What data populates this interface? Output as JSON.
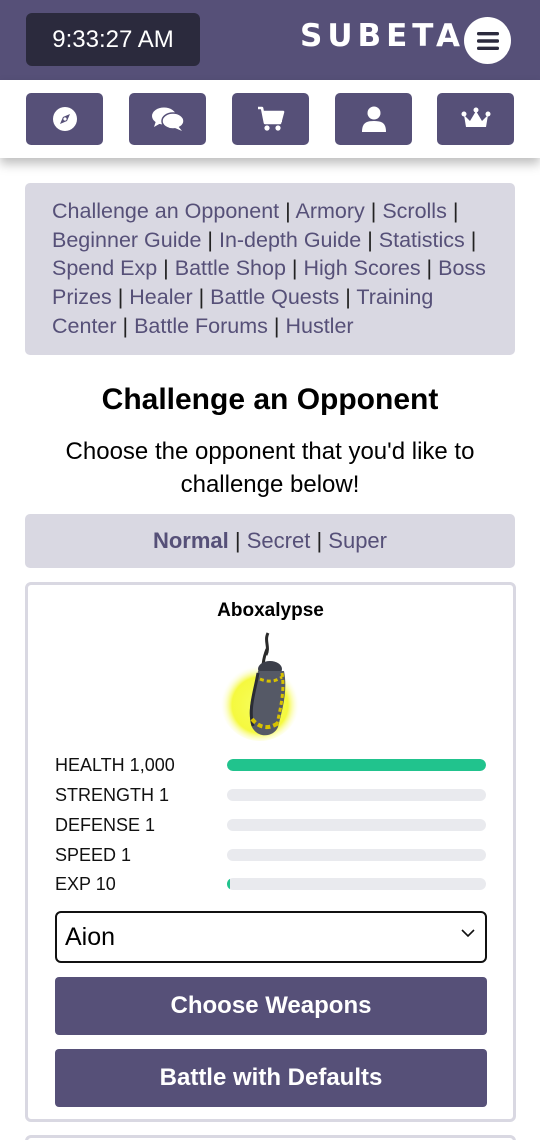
{
  "header": {
    "clock": "9:33:27 AM",
    "brand": "SUBETA"
  },
  "nav": {
    "icons": [
      "compass-icon",
      "chat-icon",
      "cart-icon",
      "user-icon",
      "crown-icon"
    ]
  },
  "links": [
    "Challenge an Opponent",
    "Armory",
    "Scrolls",
    "Beginner Guide",
    "In-depth Guide",
    "Statistics",
    "Spend Exp",
    "Battle Shop",
    "High Scores",
    "Boss Prizes",
    "Healer",
    "Battle Quests",
    "Training Center",
    "Battle Forums",
    "Hustler"
  ],
  "page": {
    "title": "Challenge an Opponent",
    "subtitle": "Choose the opponent that you'd like to challenge below!"
  },
  "tabs": {
    "normal": "Normal",
    "secret": "Secret",
    "super": "Super",
    "active": "Normal"
  },
  "opponent": {
    "name": "Aboxalypse",
    "stats": [
      {
        "label": "HEALTH 1,000",
        "fill": 1.0
      },
      {
        "label": "STRENGTH 1",
        "fill": 0.0
      },
      {
        "label": "DEFENSE 1",
        "fill": 0.0
      },
      {
        "label": "SPEED 1",
        "fill": 0.0
      },
      {
        "label": "EXP 10",
        "fill": 0.01
      }
    ],
    "pet_select": "Aion",
    "choose_weapons": "Choose Weapons",
    "battle_defaults": "Battle with Defaults"
  },
  "colors": {
    "brand": "#565078",
    "panel": "#d9d8e2",
    "health": "#21c38d"
  }
}
